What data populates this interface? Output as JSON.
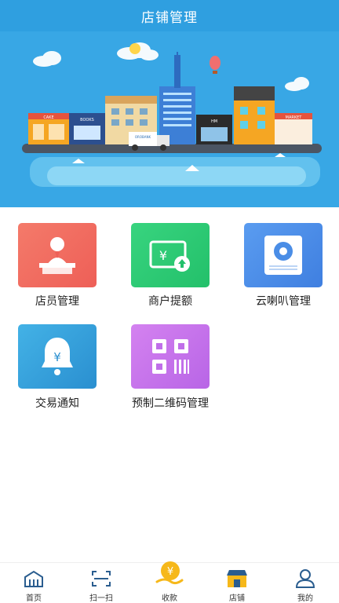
{
  "header": {
    "title": "店铺管理"
  },
  "banner": {
    "signs": {
      "cake": "CAKE",
      "books": "BOOKS",
      "bank": "OROBANK",
      "hm": "HM",
      "market": "MARKET"
    }
  },
  "menu": {
    "items": [
      {
        "label": "店员管理",
        "color": "#f16f62",
        "icon": "clerk-icon"
      },
      {
        "label": "商户提额",
        "color": "#2fcf78",
        "icon": "wallet-icon"
      },
      {
        "label": "云喇叭管理",
        "color": "#4f8fe8",
        "icon": "speaker-icon"
      },
      {
        "label": "交易通知",
        "color": "#3aa5dd",
        "icon": "bell-icon"
      },
      {
        "label": "预制二维码管理",
        "color": "#c977ec",
        "icon": "qr-code-icon"
      }
    ]
  },
  "tabbar": {
    "items": [
      {
        "label": "首页",
        "icon": "home-icon"
      },
      {
        "label": "扫一扫",
        "icon": "scan-icon"
      },
      {
        "label": "收款",
        "icon": "receive-money-icon"
      },
      {
        "label": "店铺",
        "icon": "store-icon"
      },
      {
        "label": "我的",
        "icon": "profile-icon"
      }
    ],
    "active_index": 3
  }
}
